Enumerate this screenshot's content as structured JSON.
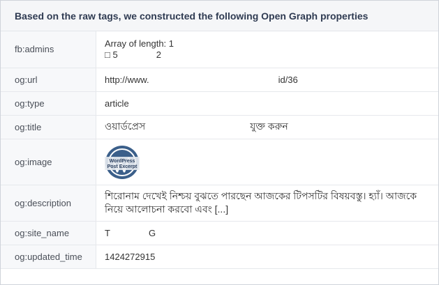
{
  "panel": {
    "title": "Based on the raw tags, we constructed the following Open Graph properties"
  },
  "rows": {
    "admins": {
      "key": "fb:admins",
      "line1": "Array of length: 1",
      "line2_a": "□ 5",
      "line2_b": "2"
    },
    "url": {
      "key": "og:url",
      "value_a": "http://www.",
      "value_b": "id/36"
    },
    "type": {
      "key": "og:type",
      "value": "article"
    },
    "title": {
      "key": "og:title",
      "value_a": "ওয়ার্ডপ্রেস",
      "value_b": "যুক্ত করুন"
    },
    "image": {
      "key": "og:image",
      "thumb_text_1": "WordPress",
      "thumb_text_2": "Post Excerpt"
    },
    "description": {
      "key": "og:description",
      "line1": "শিরোনাম দেখেই নিশ্চয় বুঝতে পারছেন আজকের টিপসটির বিষয়বস্তু। হ্যাঁ। আজকে",
      "line2": "নিয়ে আলোচনা করবো এবং [...]"
    },
    "site_name": {
      "key": "og:site_name",
      "value_a": "T",
      "value_b": "G"
    },
    "updated_time": {
      "key": "og:updated_time",
      "value": "1424272915"
    }
  },
  "colors": {
    "header_bg": "#f5f6f8",
    "key_bg": "#f7f8fa",
    "thumb_bg": "#3b5f8a"
  }
}
